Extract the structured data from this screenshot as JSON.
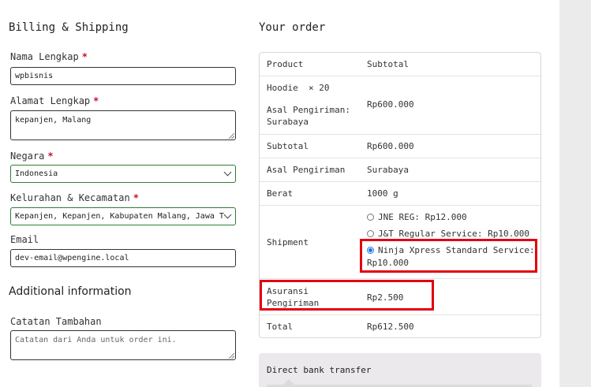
{
  "billing": {
    "title": "Billing & Shipping",
    "required_mark": "*",
    "fields": {
      "name": {
        "label": "Nama Lengkap",
        "value": "wpbisnis"
      },
      "address": {
        "label": "Alamat Lengkap",
        "value": "kepanjen, Malang"
      },
      "country": {
        "label": "Negara",
        "value": "Indonesia"
      },
      "district": {
        "label": "Kelurahan & Kecamatan",
        "value": "Kepanjen, Kepanjen, Kabupaten Malang, Jawa Ti..."
      },
      "email": {
        "label": "Email",
        "value": "dev-email@wpengine.local"
      }
    }
  },
  "additional": {
    "title": "Additional information",
    "notes_label": "Catatan Tambahan",
    "notes_placeholder": "Catatan dari Anda untuk order ini."
  },
  "order": {
    "title": "Your order",
    "header": {
      "product": "Product",
      "subtotal": "Subtotal"
    },
    "item": {
      "name": "Hoodie",
      "qty": "× 20",
      "origin_label": "Asal Pengiriman:",
      "origin_value": "Surabaya",
      "price": "Rp600.000"
    },
    "subtotal": {
      "label": "Subtotal",
      "value": "Rp600.000"
    },
    "origin": {
      "label": "Asal Pengiriman",
      "value": "Surabaya"
    },
    "weight": {
      "label": "Berat",
      "value": "1000 g"
    },
    "shipment": {
      "label": "Shipment",
      "options": [
        {
          "label": "JNE REG: Rp12.000",
          "checked": false
        },
        {
          "label": "J&T Regular Service: Rp10.000",
          "checked": false
        },
        {
          "label_line1": "Ninja Xpress Standard Service:",
          "label_line2": "Rp10.000",
          "checked": true
        }
      ]
    },
    "insurance": {
      "label_line1": "Asuransi",
      "label_line2": "Pengiriman",
      "value": "Rp2.500"
    },
    "total": {
      "label": "Total",
      "value": "Rp612.500"
    }
  },
  "payment": {
    "method_label": "Direct bank transfer"
  },
  "colors": {
    "highlight": "#e3000f",
    "radio_checked": "#1a73e8",
    "required": "#c8102e"
  }
}
